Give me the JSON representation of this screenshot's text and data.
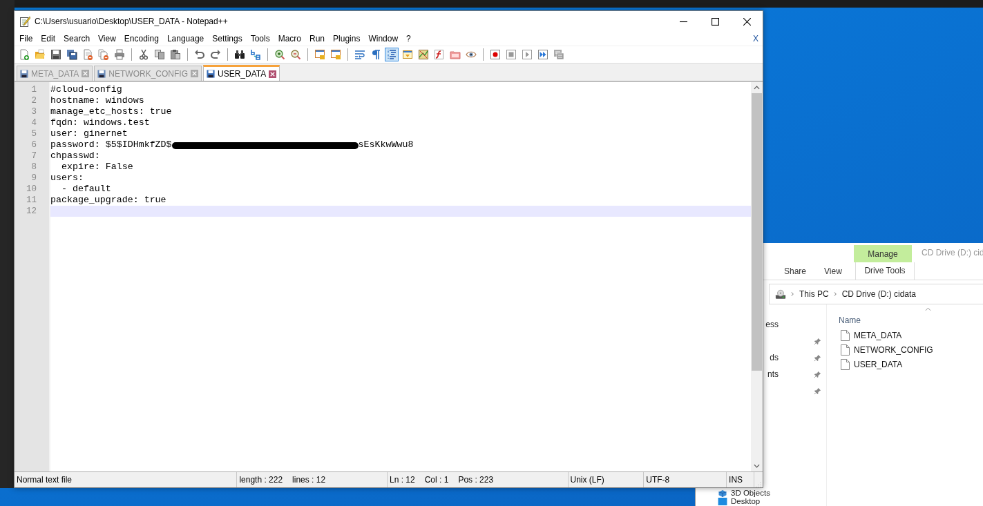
{
  "notepad": {
    "title": "C:\\Users\\usuario\\Desktop\\USER_DATA - Notepad++",
    "menu": [
      "File",
      "Edit",
      "Search",
      "View",
      "Encoding",
      "Language",
      "Settings",
      "Tools",
      "Macro",
      "Run",
      "Plugins",
      "Window",
      "?"
    ],
    "close_document": "X",
    "toolbar": [
      {
        "kind": "new",
        "pressed": false
      },
      {
        "kind": "open",
        "pressed": false
      },
      {
        "kind": "save",
        "pressed": false
      },
      {
        "kind": "saveall",
        "pressed": false
      },
      {
        "kind": "close",
        "pressed": false
      },
      {
        "kind": "closeall",
        "pressed": false
      },
      {
        "kind": "print",
        "pressed": false
      },
      {
        "kind": "separator"
      },
      {
        "kind": "cut",
        "pressed": false
      },
      {
        "kind": "copy",
        "pressed": false
      },
      {
        "kind": "paste",
        "pressed": false
      },
      {
        "kind": "separator"
      },
      {
        "kind": "undo",
        "pressed": false
      },
      {
        "kind": "redo",
        "pressed": false
      },
      {
        "kind": "separator"
      },
      {
        "kind": "find",
        "pressed": false
      },
      {
        "kind": "replace",
        "pressed": false
      },
      {
        "kind": "separator"
      },
      {
        "kind": "zoomin",
        "pressed": false
      },
      {
        "kind": "zoomout",
        "pressed": false
      },
      {
        "kind": "separator"
      },
      {
        "kind": "syncv",
        "pressed": false
      },
      {
        "kind": "synch",
        "pressed": false
      },
      {
        "kind": "separator"
      },
      {
        "kind": "wrap",
        "pressed": false
      },
      {
        "kind": "pilcrow",
        "pressed": false
      },
      {
        "kind": "indent",
        "pressed": true
      },
      {
        "kind": "panel",
        "pressed": false
      },
      {
        "kind": "map",
        "pressed": false
      },
      {
        "kind": "function",
        "pressed": false
      },
      {
        "kind": "folder",
        "pressed": false
      },
      {
        "kind": "eye",
        "pressed": false
      },
      {
        "kind": "separator"
      },
      {
        "kind": "record",
        "pressed": false
      },
      {
        "kind": "stop",
        "pressed": false
      },
      {
        "kind": "play",
        "pressed": false
      },
      {
        "kind": "playmulti",
        "pressed": false
      },
      {
        "kind": "savemacro",
        "pressed": false
      }
    ],
    "tabs": [
      {
        "label": "META_DATA",
        "selected": false
      },
      {
        "label": "NETWORK_CONFIG",
        "selected": false
      },
      {
        "label": "USER_DATA",
        "selected": true
      }
    ],
    "lines": [
      {
        "number": "1",
        "kind": "plain",
        "text": "#cloud-config",
        "selected": false
      },
      {
        "number": "2",
        "kind": "plain",
        "text": "hostname: windows",
        "selected": false
      },
      {
        "number": "3",
        "kind": "plain",
        "text": "manage_etc_hosts: true",
        "selected": false
      },
      {
        "number": "4",
        "kind": "plain",
        "text": "fqdn: windows.test",
        "selected": false
      },
      {
        "number": "5",
        "kind": "plain",
        "text": "user: ginernet",
        "selected": false
      },
      {
        "number": "6",
        "kind": "redacted",
        "text": "password: $5$IDHmkfZD$",
        "after": "sEsKkwWwu8",
        "selected": false
      },
      {
        "number": "7",
        "kind": "plain",
        "text": "chpasswd:",
        "selected": false
      },
      {
        "number": "8",
        "kind": "plain",
        "text": "  expire: False",
        "selected": false
      },
      {
        "number": "9",
        "kind": "plain",
        "text": "users:",
        "selected": false
      },
      {
        "number": "10",
        "kind": "plain",
        "text": "  - default",
        "selected": false
      },
      {
        "number": "11",
        "kind": "plain",
        "text": "package_upgrade: true",
        "selected": false
      },
      {
        "number": "12",
        "kind": "plain",
        "selected": true
      }
    ],
    "status_bar": [
      {
        "texts": [
          "Normal text file"
        ]
      },
      {
        "texts": [
          "length : 222",
          "lines : 12"
        ]
      },
      {
        "texts": [
          "Ln : 12",
          "Col : 1",
          "Pos : 223"
        ]
      },
      {
        "texts": [
          "Unix (LF)"
        ]
      },
      {
        "texts": [
          "UTF-8"
        ]
      },
      {
        "texts": [
          "INS"
        ]
      }
    ]
  },
  "explorer": {
    "title": "CD Drive (D:) cid",
    "contextual_tab": "Manage",
    "ribbon_tabs": [
      {
        "label": "Share",
        "selected": false
      },
      {
        "label": "View",
        "selected": false
      },
      {
        "label": "Drive Tools",
        "selected": true
      }
    ],
    "breadcrumb": [
      "This PC",
      "CD Drive (D:) cidata"
    ],
    "nav_items": [
      {
        "label": "ess",
        "pinned": false
      },
      {
        "pinned": true
      },
      {
        "label": "ds",
        "pinned": true
      },
      {
        "label": "nts",
        "pinned": true
      },
      {
        "pinned": true
      }
    ],
    "nav_bottom": [
      {
        "label": "3D Objects",
        "kind": "objects"
      },
      {
        "label": "Desktop",
        "kind": "desktop"
      }
    ],
    "column": "Name",
    "files": [
      "META_DATA",
      "NETWORK_CONFIG",
      "USER_DATA"
    ]
  }
}
